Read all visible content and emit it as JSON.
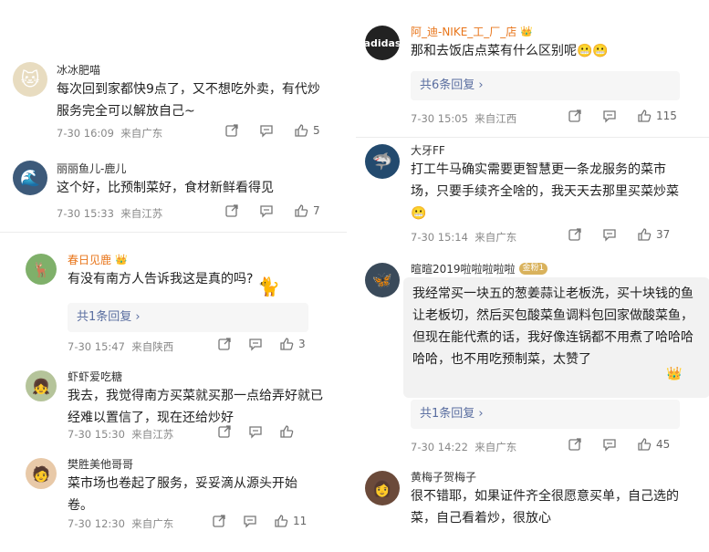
{
  "left": [
    {
      "user": "冰冰肥喵",
      "text": "每次回到家都快9点了，又不想吃外卖，有代炒服务完全可以解放自己~",
      "time": "7-30 16:09",
      "loc": "来自广东",
      "likes": "5",
      "avatar_color": "#e8dcc0"
    },
    {
      "user": "丽丽鱼儿-鹿儿",
      "text": "这个好，比预制菜好，食材新鲜看得见",
      "time": "7-30 15:33",
      "loc": "来自江苏",
      "likes": "7",
      "avatar_color": "#3d5a7a"
    },
    {
      "user": "春日见鹿",
      "badge": "👑",
      "text": "有没有南方人告诉我这是真的吗?",
      "reply": "共1条回复 ›",
      "time": "7-30 15:47",
      "loc": "来自陕西",
      "likes": "3",
      "avatar_color": "#7fb06a"
    },
    {
      "user": "虾虾爱吃糖",
      "text": "我去，我觉得南方买菜就买那一点给弄好就已经难以置信了，现在还给炒好",
      "time": "7-30 15:30",
      "loc": "来自江苏",
      "likes": "",
      "avatar_color": "#b5c49a"
    },
    {
      "user": "樊胜美他哥哥",
      "text": "菜市场也卷起了服务，妥妥滴从源头开始卷。",
      "time": "7-30 12:30",
      "loc": "来自广东",
      "likes": "11",
      "avatar_color": "#e8c9a8"
    }
  ],
  "right": [
    {
      "user": "阿_迪-NIKE_工_厂_店",
      "badge": "👑",
      "text": "那和去饭店点菜有什么区别呢😬😬",
      "reply": "共6条回复 ›",
      "time": "7-30 15:05",
      "loc": "来自江西",
      "likes": "115",
      "avatar_color": "#222222"
    },
    {
      "user": "大牙FF",
      "text": "打工牛马确实需要更智慧更一条龙服务的菜市场，只要手续齐全啥的，我天天去那里买菜炒菜😬",
      "time": "7-30 15:14",
      "loc": "来自广东",
      "likes": "37",
      "avatar_color": "#234a6e"
    },
    {
      "user": "暄暄2019啦啦啦啦啦",
      "gold": "金粉1",
      "text": "我经常买一块五的葱姜蒜让老板洗，买十块钱的鱼让老板切，然后买包酸菜鱼调料包回家做酸菜鱼，但现在能代煮的话，我好像连锅都不用煮了哈哈哈哈哈，也不用吃预制菜，太赞了",
      "reply": "共1条回复 ›",
      "time": "7-30 14:22",
      "loc": "来自广东",
      "likes": "45",
      "avatar_color": "#3a4a5a"
    },
    {
      "user": "黄梅子贺梅子",
      "text": "很不错耶，如果证件齐全很愿意买单，自己选的菜，自己看着炒，很放心",
      "avatar_color": "#6b4a3a"
    }
  ]
}
